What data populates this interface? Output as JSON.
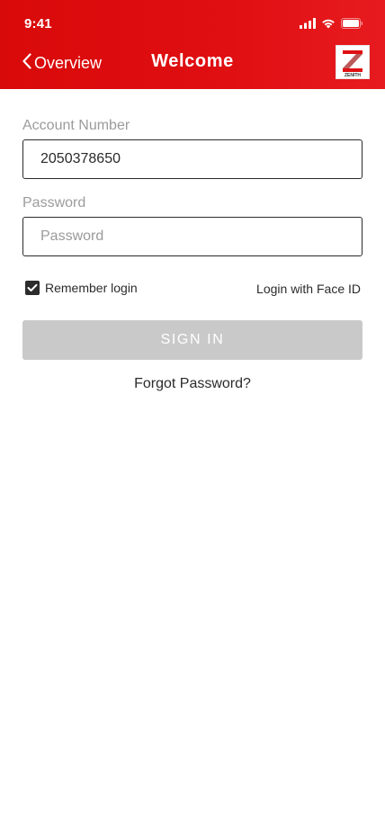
{
  "status_bar": {
    "time": "9:41",
    "icons": [
      "cellular-signal-icon",
      "wifi-icon",
      "battery-icon"
    ]
  },
  "header": {
    "back_label": "Overview",
    "title": "Welcome",
    "logo_text": "ZENITH",
    "logo_letter": "Z",
    "brand_color": "#e00f12"
  },
  "form": {
    "account_number": {
      "label": "Account Number",
      "value": "2050378650"
    },
    "password": {
      "label": "Password",
      "placeholder": "Password"
    },
    "remember_login": {
      "label": "Remember login",
      "checked": true
    },
    "face_id_label": "Login with Face ID",
    "sign_in_label": "SIGN IN",
    "sign_in_color": "#c9c9c9",
    "forgot_password_label": "Forgot Password?"
  }
}
